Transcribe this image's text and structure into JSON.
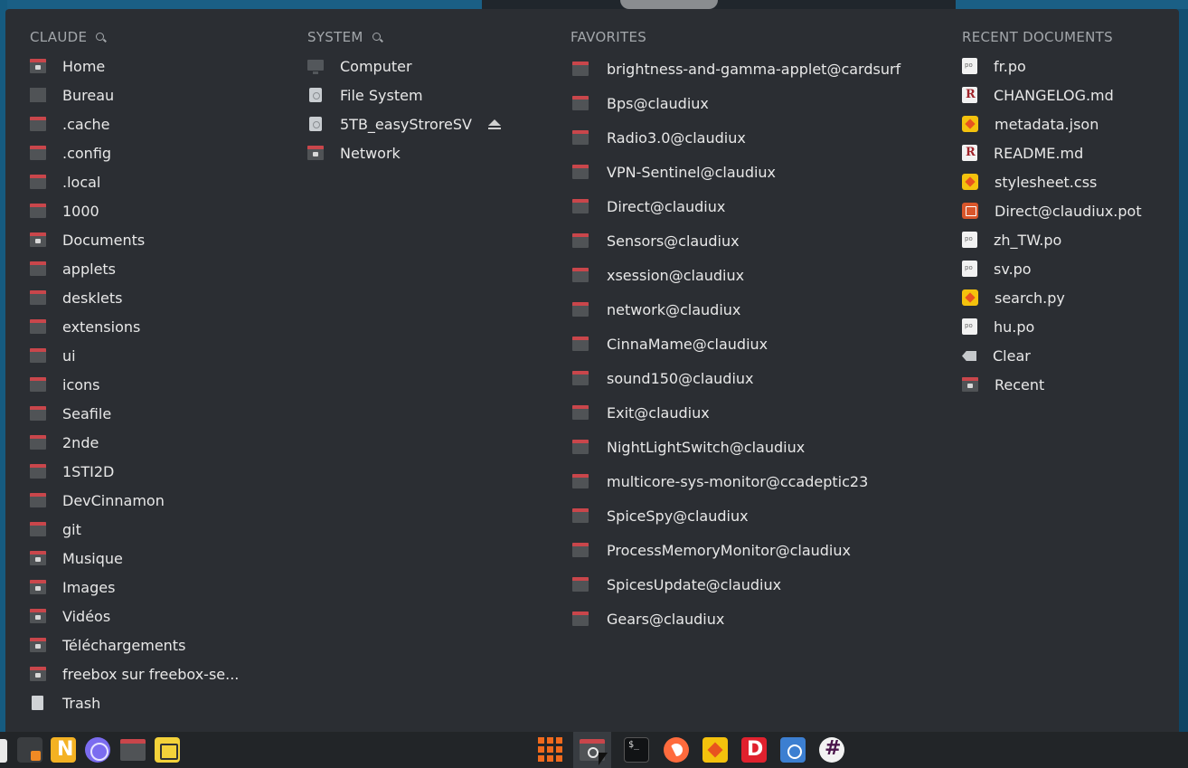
{
  "columns": {
    "user": {
      "header": "CLAUDE",
      "items": [
        {
          "label": "Home",
          "icon": "home-folder-icon"
        },
        {
          "label": "Bureau",
          "icon": "desktop-folder-icon"
        },
        {
          "label": ".cache",
          "icon": "folder-icon"
        },
        {
          "label": ".config",
          "icon": "folder-icon"
        },
        {
          "label": ".local",
          "icon": "folder-icon"
        },
        {
          "label": "1000",
          "icon": "folder-icon"
        },
        {
          "label": "Documents",
          "icon": "documents-folder-icon"
        },
        {
          "label": "applets",
          "icon": "folder-icon"
        },
        {
          "label": "desklets",
          "icon": "folder-icon"
        },
        {
          "label": "extensions",
          "icon": "folder-icon"
        },
        {
          "label": "ui",
          "icon": "folder-icon"
        },
        {
          "label": "icons",
          "icon": "folder-icon"
        },
        {
          "label": "Seafile",
          "icon": "folder-icon"
        },
        {
          "label": "2nde",
          "icon": "folder-icon"
        },
        {
          "label": "1STI2D",
          "icon": "folder-icon"
        },
        {
          "label": "DevCinnamon",
          "icon": "folder-icon"
        },
        {
          "label": "git",
          "icon": "folder-icon"
        },
        {
          "label": "Musique",
          "icon": "music-folder-icon"
        },
        {
          "label": "Images",
          "icon": "pictures-folder-icon"
        },
        {
          "label": "Vidéos",
          "icon": "videos-folder-icon"
        },
        {
          "label": "Téléchargements",
          "icon": "downloads-folder-icon"
        },
        {
          "label": "freebox sur freebox-se...",
          "icon": "network-folder-icon"
        },
        {
          "label": "Trash",
          "icon": "trash-icon"
        }
      ]
    },
    "system": {
      "header": "SYSTEM",
      "items": [
        {
          "label": "Computer",
          "icon": "computer-icon"
        },
        {
          "label": "File System",
          "icon": "drive-icon"
        },
        {
          "label": "5TB_easyStroreSV",
          "icon": "drive-icon"
        },
        {
          "label": "Network",
          "icon": "network-folder-icon"
        }
      ]
    },
    "favorites": {
      "header": "FAVORITES",
      "items": [
        "brightness-and-gamma-applet@cardsurf",
        "Bps@claudiux",
        "Radio3.0@claudiux",
        "VPN-Sentinel@claudiux",
        "Direct@claudiux",
        "Sensors@claudiux",
        "xsession@claudiux",
        "network@claudiux",
        "CinnaMame@claudiux",
        "sound150@claudiux",
        "Exit@claudiux",
        "NightLightSwitch@claudiux",
        "multicore-sys-monitor@ccadeptic23",
        "SpiceSpy@claudiux",
        "ProcessMemoryMonitor@claudiux",
        "SpicesUpdate@claudiux",
        "Gears@claudiux"
      ]
    },
    "recent": {
      "header": "RECENT DOCUMENTS",
      "items": [
        {
          "label": "fr.po",
          "icon": "po-file-icon"
        },
        {
          "label": "CHANGELOG.md",
          "icon": "markdown-file-icon"
        },
        {
          "label": "metadata.json",
          "icon": "json-file-icon"
        },
        {
          "label": "README.md",
          "icon": "markdown-file-icon"
        },
        {
          "label": "stylesheet.css",
          "icon": "css-file-icon"
        },
        {
          "label": "Direct@claudiux.pot",
          "icon": "pot-file-icon"
        },
        {
          "label": "zh_TW.po",
          "icon": "po-file-icon"
        },
        {
          "label": "sv.po",
          "icon": "po-file-icon"
        },
        {
          "label": "search.py",
          "icon": "python-file-icon"
        },
        {
          "label": "hu.po",
          "icon": "po-file-icon"
        },
        {
          "label": "Clear",
          "icon": "clear-icon"
        },
        {
          "label": "Recent",
          "icon": "recent-folder-icon"
        }
      ]
    }
  },
  "colors": {
    "panel": "#2b2e33",
    "folder_tab": "#c9464b",
    "header_text": "#a3a7ab",
    "item_text": "#e8e8e8",
    "taskbar": "#222528"
  }
}
